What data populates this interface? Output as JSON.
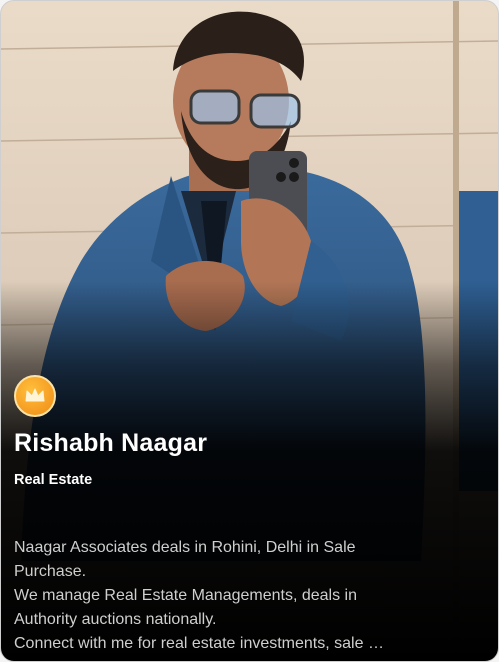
{
  "profile": {
    "name": "Rishabh Naagar",
    "category": "Real Estate",
    "badge_icon": "crown-icon",
    "description_lines": [
      "Naagar Associates deals in Rohini, Delhi in Sale",
      "Purchase.",
      "We manage Real Estate Managements, deals in",
      "Authority auctions nationally.",
      "Connect with me for real estate investments, sale …"
    ]
  },
  "colors": {
    "badge": "#f39a1b",
    "name_text": "#ffffff",
    "description_text": "#cfcfcf",
    "suit": "#2e5a8a",
    "wall": "#d9c8b6"
  }
}
